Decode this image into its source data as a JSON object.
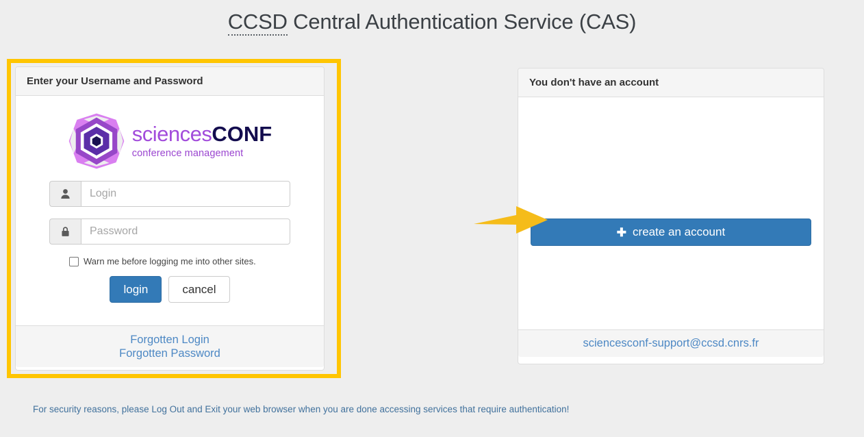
{
  "page": {
    "title_abbr": "CCSD",
    "title_rest": " Central Authentication Service (CAS)",
    "background_color": "#eeeeee",
    "accent_color": "#337ab7",
    "highlight_color": "#ffc500",
    "link_color": "#4d88c4"
  },
  "login_panel": {
    "heading": "Enter your Username and Password",
    "logo": {
      "mark_icon": "sciencesconf-hexagon-logo",
      "word_light": "sciences",
      "word_bold": "CONF",
      "tagline": "conference management",
      "color_light": "#a24cdb",
      "color_bold": "#130c4e",
      "color_tagline": "#9b46d0"
    },
    "username": {
      "icon": "user-icon",
      "value": "",
      "placeholder": "Login"
    },
    "password": {
      "icon": "lock-icon",
      "value": "",
      "placeholder": "Password"
    },
    "warn_checkbox": {
      "label": "Warn me before logging me into other sites.",
      "checked": false
    },
    "login_button": "login",
    "cancel_button": "cancel",
    "footer_links": [
      "Forgotten Login",
      "Forgotten Password"
    ]
  },
  "account_panel": {
    "heading": "You don't have an account",
    "create_button": {
      "icon": "plus-icon",
      "label": "create an account"
    },
    "support_email": "sciencesconf-support@ccsd.cnrs.fr"
  },
  "annotation": {
    "arrow_icon": "right-arrow-annotation",
    "arrow_color": "#f5bc1a"
  },
  "security_note": "For security reasons, please Log Out and Exit your web browser when you are done accessing services that require authentication!"
}
